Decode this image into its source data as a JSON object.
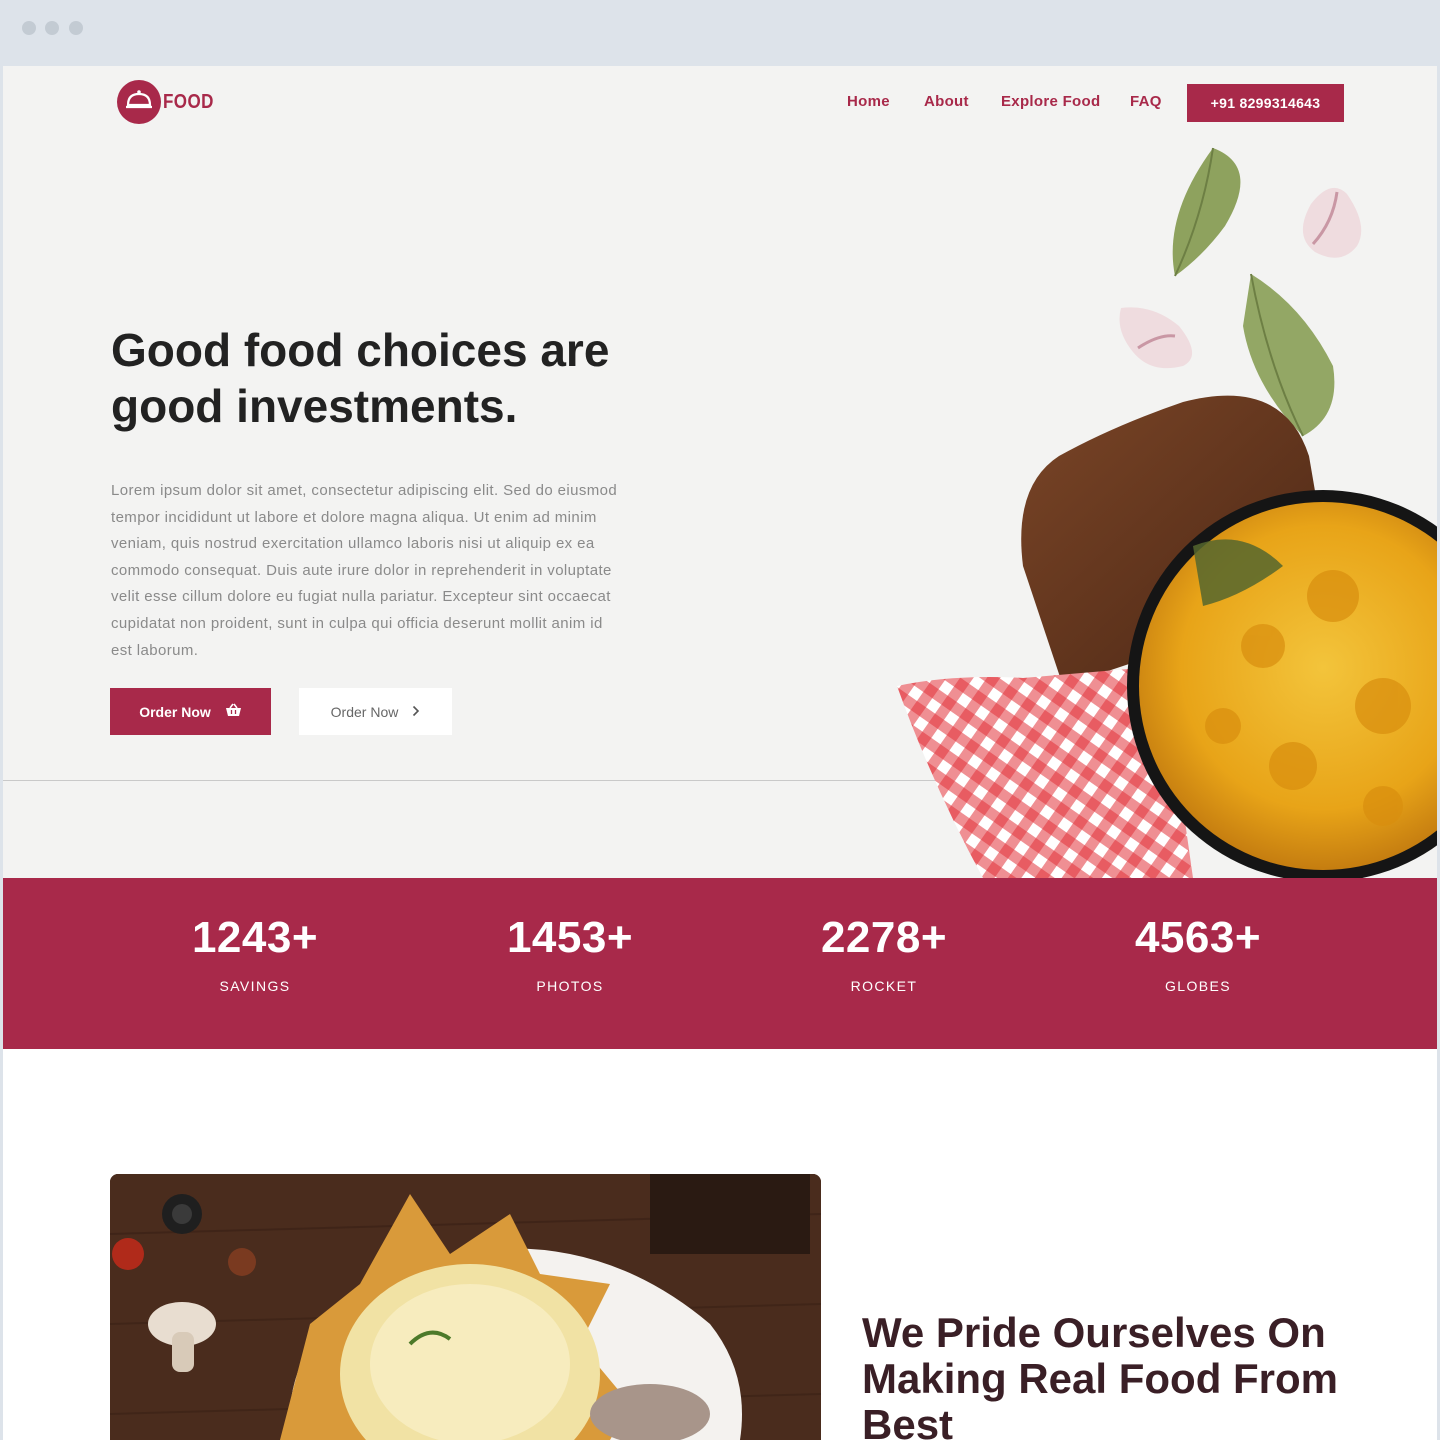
{
  "brand": {
    "name": "FOOD",
    "color": "#a8294a"
  },
  "nav": {
    "links": [
      "Home",
      "About",
      "Explore Food",
      "FAQ"
    ],
    "phone": "+91 8299314643"
  },
  "hero": {
    "title": "Good food choices are good investments.",
    "body": "Lorem ipsum dolor sit amet, consectetur adipiscing elit. Sed do eiusmod tempor incididunt ut labore et dolore magna aliqua. Ut enim ad minim veniam, quis nostrud exercitation ullamco laboris nisi ut aliquip ex ea commodo consequat. Duis aute irure dolor in reprehenderit in voluptate velit esse cillum dolore eu fugiat nulla pariatur. Excepteur sint occaecat cupidatat non proident, sunt in culpa qui officia deserunt mollit anim id est laborum.",
    "primary_button": "Order Now",
    "secondary_button": "Order Now"
  },
  "stats": [
    {
      "value": "1243+",
      "label": "SAVINGS"
    },
    {
      "value": "1453+",
      "label": "PHOTOS"
    },
    {
      "value": "2278+",
      "label": "ROCKET"
    },
    {
      "value": "4563+",
      "label": "GLOBES"
    }
  ],
  "about": {
    "title": "We Pride Ourselves On Making Real Food From Best"
  }
}
